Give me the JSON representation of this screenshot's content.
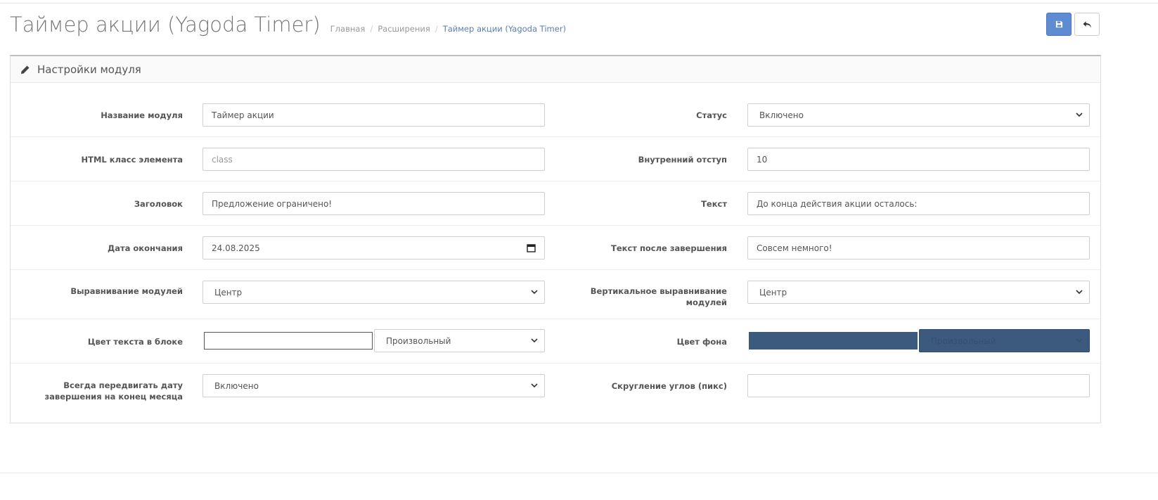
{
  "header": {
    "title": "Таймер акции (Yagoda Timer)",
    "breadcrumb": [
      "Главная",
      "Расширения",
      "Таймер акции (Yagoda Timer)"
    ]
  },
  "panel": {
    "title": "Настройки модуля"
  },
  "fields": {
    "module_name": {
      "label": "Название модуля",
      "value": "Таймер акции"
    },
    "status": {
      "label": "Статус",
      "value": "Включено"
    },
    "html_class": {
      "label": "HTML класс элемента",
      "placeholder": "class"
    },
    "padding": {
      "label": "Внутренний отступ",
      "value": "10"
    },
    "heading": {
      "label": "Заголовок",
      "value": "Предложение ограничено!"
    },
    "text": {
      "label": "Текст",
      "value": "До конца действия акции осталось:"
    },
    "end_date": {
      "label": "Дата окончания",
      "value": "24.08.2025"
    },
    "text_after": {
      "label": "Текст после завершения",
      "value": "Совсем немного!"
    },
    "align_modules": {
      "label": "Выравнивание модулей",
      "value": "Центр"
    },
    "valign_modules": {
      "label": "Вертикальное выравнивание модулей",
      "value": "Центр"
    },
    "text_color": {
      "label": "Цвет текста в блоке",
      "swatch": "#ffffff",
      "mode": "Произвольный"
    },
    "bg_color": {
      "label": "Цвет фона",
      "swatch": "#3b5a7e",
      "mode": "Произвольный"
    },
    "always_shift": {
      "label": "Всегда передвигать дату завершения на конец месяца",
      "value": "Включено"
    },
    "corner_radius": {
      "label": "Скругление углов (пикс)",
      "value": ""
    }
  },
  "colors": {
    "save_button": "#5e8cd2",
    "bg_swatch": "#3b5a7e",
    "breadcrumb_active": "#5b7db1"
  }
}
